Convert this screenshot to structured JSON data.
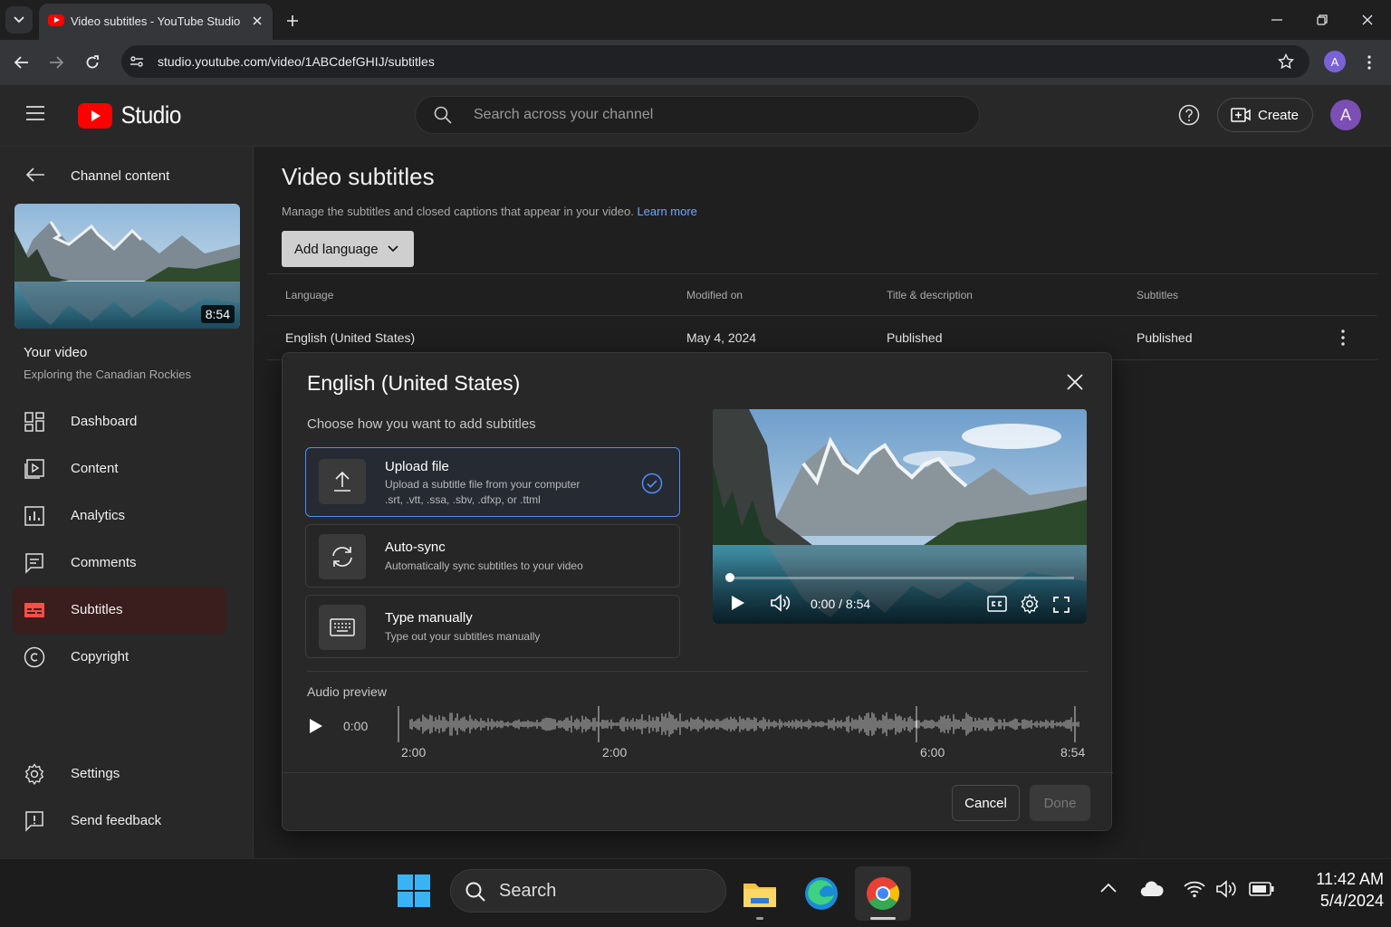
{
  "browser": {
    "tab_title": "Video subtitles - YouTube Studio",
    "url": "studio.youtube.com/video/1ABCdefGHIJ/subtitles",
    "profile_initial": "A"
  },
  "header": {
    "logo_text": "Studio",
    "search_placeholder": "Search across your channel",
    "create_label": "Create",
    "avatar_initial": "A"
  },
  "sidebar": {
    "back_label": "Channel content",
    "thumbnail_duration": "8:54",
    "your_video_label": "Your video",
    "video_title": "Exploring the Canadian Rockies",
    "items": [
      {
        "label": "Dashboard",
        "icon": "dashboard-icon"
      },
      {
        "label": "Content",
        "icon": "content-icon"
      },
      {
        "label": "Analytics",
        "icon": "analytics-icon"
      },
      {
        "label": "Comments",
        "icon": "comments-icon"
      },
      {
        "label": "Subtitles",
        "icon": "subtitles-icon",
        "active": true
      },
      {
        "label": "Copyright",
        "icon": "copyright-icon"
      }
    ],
    "settings_label": "Settings",
    "feedback_label": "Send feedback"
  },
  "main": {
    "title": "Video subtitles",
    "description": "Manage the subtitles and closed captions that appear in your video.",
    "learn_more": "Learn more",
    "add_language": "Add language",
    "columns": [
      "Language",
      "Modified on",
      "Title & description",
      "Subtitles"
    ],
    "row": {
      "language": "English (United States)",
      "modified": "May 4, 2024",
      "title_desc": "Published",
      "subtitles": "Published"
    }
  },
  "dialog": {
    "title": "English (United States)",
    "subtitle": "Choose how you want to add subtitles",
    "options": [
      {
        "title": "Upload file",
        "desc": "Upload a subtitle file from your computer",
        "desc2": ".srt, .vtt, .ssa, .sbv, .dfxp, or .ttml",
        "icon": "upload-icon",
        "selected": true
      },
      {
        "title": "Auto-sync",
        "desc": "Automatically sync subtitles to your video",
        "icon": "sync-icon"
      },
      {
        "title": "Type manually",
        "desc": "Type out your subtitles manually",
        "icon": "keyboard-icon"
      }
    ],
    "player_time": "0:00 / 8:54",
    "player_progress": 0.0,
    "audio_label": "Audio preview",
    "audio_time": "0:00",
    "wave_ticks": [
      "2:00",
      "2:00",
      "6:00",
      "8:54"
    ],
    "cancel": "Cancel",
    "done": "Done"
  },
  "taskbar": {
    "search_label": "Search",
    "time": "11:42 AM",
    "date": "5/4/2024"
  },
  "colors": {
    "accent_blue": "#4f8ef7",
    "youtube_red": "#ff0000",
    "subtitles_active": "#ff4e45"
  }
}
